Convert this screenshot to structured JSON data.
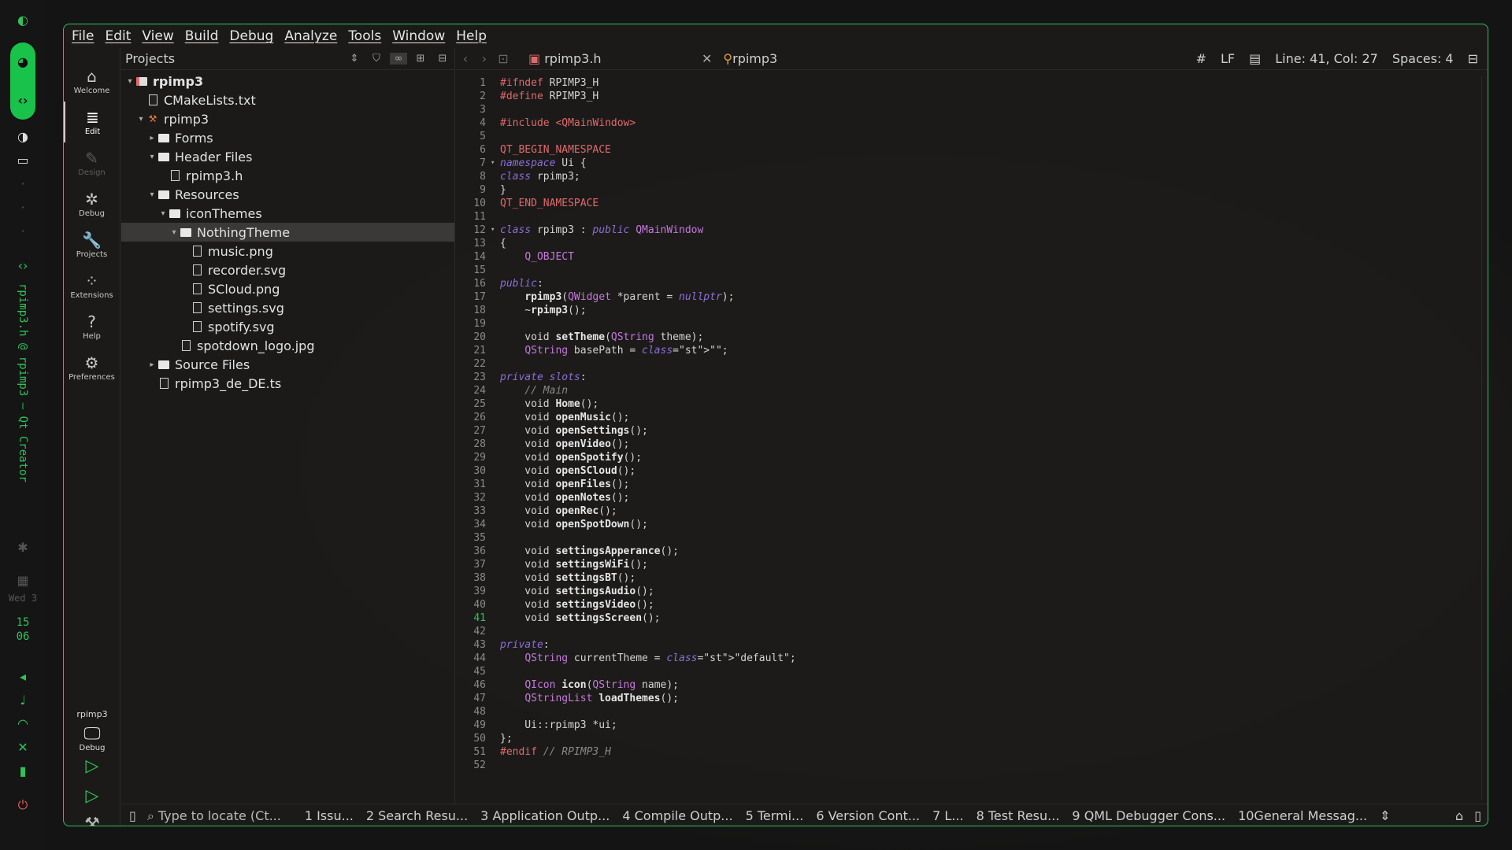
{
  "dock": {
    "vertical_title": "rpimp3.h @ rpimp3 – Qt Creator",
    "date": "Wed 3",
    "time_h": "15",
    "time_m": "06"
  },
  "menubar": [
    "File",
    "Edit",
    "View",
    "Build",
    "Debug",
    "Analyze",
    "Tools",
    "Window",
    "Help"
  ],
  "modes": [
    {
      "label": "Welcome",
      "icon": "⌂",
      "state": "normal"
    },
    {
      "label": "Edit",
      "icon": "≣",
      "state": "active"
    },
    {
      "label": "Design",
      "icon": "✎",
      "state": "disabled"
    },
    {
      "label": "Debug",
      "icon": "✲",
      "state": "normal"
    },
    {
      "label": "Projects",
      "icon": "🔧",
      "state": "normal"
    },
    {
      "label": "Extensions",
      "icon": "⁘",
      "state": "normal"
    },
    {
      "label": "Help",
      "icon": "?",
      "state": "normal"
    },
    {
      "label": "Preferences",
      "icon": "⚙",
      "state": "normal"
    }
  ],
  "kit": {
    "project": "rpimp3",
    "mode": "Debug"
  },
  "projects": {
    "title": "Projects",
    "tree": [
      {
        "label": "rpimp3",
        "depth": 0,
        "twisty": "▾",
        "icon": "project",
        "bold": true
      },
      {
        "label": "CMakeLists.txt",
        "depth": 1,
        "twisty": "",
        "icon": "file"
      },
      {
        "label": "rpimp3",
        "depth": 1,
        "twisty": "▾",
        "icon": "build"
      },
      {
        "label": "Forms",
        "depth": 2,
        "twisty": "▸",
        "icon": "folder"
      },
      {
        "label": "Header Files",
        "depth": 2,
        "twisty": "▾",
        "icon": "folder"
      },
      {
        "label": "rpimp3.h",
        "depth": 3,
        "twisty": "",
        "icon": "file"
      },
      {
        "label": "Resources",
        "depth": 2,
        "twisty": "▾",
        "icon": "folder"
      },
      {
        "label": "iconThemes",
        "depth": 3,
        "twisty": "▾",
        "icon": "folder"
      },
      {
        "label": "NothingTheme",
        "depth": 4,
        "twisty": "▾",
        "icon": "folder",
        "selected": true
      },
      {
        "label": "music.png",
        "depth": 5,
        "twisty": "",
        "icon": "file"
      },
      {
        "label": "recorder.svg",
        "depth": 5,
        "twisty": "",
        "icon": "file"
      },
      {
        "label": "SCloud.png",
        "depth": 5,
        "twisty": "",
        "icon": "file"
      },
      {
        "label": "settings.svg",
        "depth": 5,
        "twisty": "",
        "icon": "file"
      },
      {
        "label": "spotify.svg",
        "depth": 5,
        "twisty": "",
        "icon": "file"
      },
      {
        "label": "spotdown_logo.jpg",
        "depth": 4,
        "twisty": "",
        "icon": "file"
      },
      {
        "label": "Source Files",
        "depth": 2,
        "twisty": "▸",
        "icon": "folder"
      },
      {
        "label": "rpimp3_de_DE.ts",
        "depth": 2,
        "twisty": "",
        "icon": "file"
      }
    ]
  },
  "editor": {
    "file": "rpimp3.h",
    "symbol": "rpimp3",
    "hash": "#",
    "eol": "LF",
    "position": "Line: 41, Col: 27",
    "indent": "Spaces: 4",
    "current_line": 41,
    "lines": [
      "#ifndef RPIMP3_H",
      "#define RPIMP3_H",
      "",
      "#include <QMainWindow>",
      "",
      "QT_BEGIN_NAMESPACE",
      "namespace Ui {",
      "class rpimp3;",
      "}",
      "QT_END_NAMESPACE",
      "",
      "class rpimp3 : public QMainWindow",
      "{",
      "    Q_OBJECT",
      "",
      "public:",
      "    rpimp3(QWidget *parent = nullptr);",
      "    ~rpimp3();",
      "",
      "    void setTheme(QString theme);",
      "    QString basePath = \"\";",
      "",
      "private slots:",
      "    // Main",
      "    void Home();",
      "    void openMusic();",
      "    void openSettings();",
      "    void openVideo();",
      "    void openSpotify();",
      "    void openSCloud();",
      "    void openFiles();",
      "    void openNotes();",
      "    void openRec();",
      "    void openSpotDown();",
      "",
      "    void settingsApperance();",
      "    void settingsWiFi();",
      "    void settingsBT();",
      "    void settingsAudio();",
      "    void settingsVideo();",
      "    void settingsScreen();",
      "",
      "private:",
      "    QString currentTheme = \"default\";",
      "",
      "    QIcon icon(QString name);",
      "    QStringList loadThemes();",
      "",
      "    Ui::rpimp3 *ui;",
      "};",
      "#endif // RPIMP3_H",
      ""
    ]
  },
  "statusbar": {
    "locate_placeholder": "Type to locate (Ct...",
    "panes": [
      "1 Issu...",
      "2 Search Resu...",
      "3 Application Outp...",
      "4 Compile Outp...",
      "5 Termi...",
      "6 Version Cont...",
      "7 L...",
      "8 Test Resu...",
      "9 QML Debugger Cons...",
      "10General Messag..."
    ]
  }
}
